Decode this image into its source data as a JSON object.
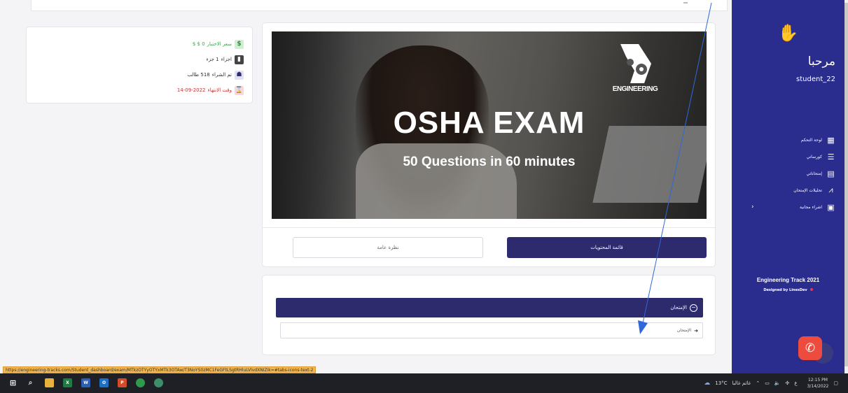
{
  "info": {
    "price_label": "سعر الاختبار",
    "price_value": "0 $ $",
    "parts_label": "اجزاء",
    "parts_value": "1 جزء",
    "buyers_label": "تم الشراء",
    "buyers_value": "518 طالب",
    "end_label": "وقت الانتهاء",
    "end_value": "14-09-2022"
  },
  "banner": {
    "title": "OSHA EXAM",
    "subtitle": "50 Questions in 60 minutes",
    "brand": "ENGINEERING"
  },
  "tabs": {
    "contents": "قائمة المحتويات",
    "overview": "نظرة عامة"
  },
  "exam": {
    "section_title": "الإمتحان",
    "item_title": "الإمتحان"
  },
  "sidebar": {
    "greeting": "مرحبا",
    "username": "student_22",
    "nav": [
      {
        "label": "لوحة التحكم"
      },
      {
        "label": "كورساتي"
      },
      {
        "label": "إمتحاناتي"
      },
      {
        "label": "تحليلات الإمتحان"
      },
      {
        "label": "اشراء مجانية"
      }
    ],
    "footer_title": "Engineering Track 2021",
    "footer_sub": "Designed by LinesDev"
  },
  "status_url": "https://engineering-tracks.com/Student_dashboard/exam/MTkzOTYyOTYxMTk3OTAw/T3NoYS0zMC1FeGFtLSgtRHluLVlvdXNIZik=#tabs-icons-text-2",
  "taskbar": {
    "weather": "13°C",
    "weather_desc": "غائم غالبا",
    "lang": "ع",
    "time": "12:15 PM",
    "date": "3/14/2022"
  },
  "colors": {
    "primary": "#2d2a6e",
    "sidebar": "#2a2c8e",
    "price_green": "#3da34a",
    "end_red": "#d22d2d",
    "fab": "#ee4b3f"
  }
}
